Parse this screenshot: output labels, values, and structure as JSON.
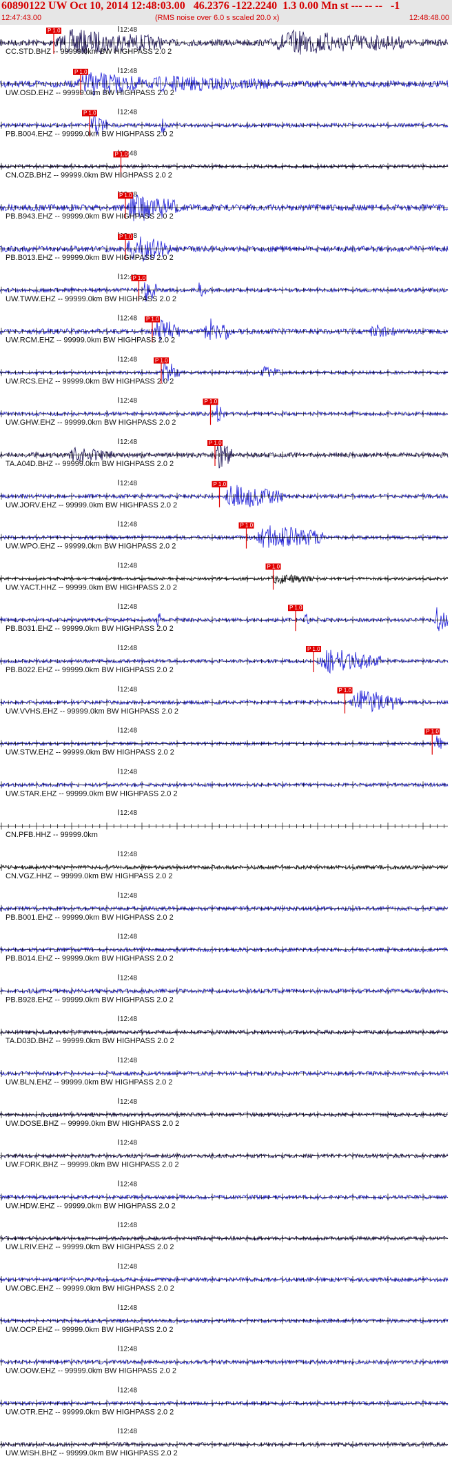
{
  "header": {
    "title": "60890122 UW Oct 10, 2014 12:48:03.00   46.2376 -122.2240  1.3 0.00 Mn st --- -- --   -1",
    "start_time": "12:47:43.00",
    "rms_note": "(RMS noise over 6.0 s scaled 20.0 x)",
    "end_time": "12:48:48.00"
  },
  "colors": {
    "title": "#d40000",
    "header_bg": "#e6e6e6",
    "pick": "#e00000",
    "trace_blue": "#1a1ad6",
    "trace_dark": "#140a50",
    "trace_black": "#000000"
  },
  "chart_data": {
    "type": "seismogram",
    "title": "60890122 UW Oct 10, 2014 12:48:03.00",
    "time_range": [
      "12:47:43.00",
      "12:48:48.00"
    ],
    "minute_label": "12:48",
    "pick_label": "P 1.0",
    "traces": [
      {
        "label": "CC.STD.BHZ -- 99999.0km BW  HIGHPASS  2.0  2",
        "pick": 0.12,
        "color": "dark",
        "amp": 1.0,
        "env": [
          [
            0.12,
            0.36,
            0.9
          ],
          [
            0.6,
            0.9,
            0.8
          ]
        ]
      },
      {
        "label": "UW.OSD.EHZ -- 99999.0km BW  HIGHPASS  2.0  2",
        "pick": 0.18,
        "color": "blue",
        "amp": 1.0,
        "env": [
          [
            0.17,
            0.32,
            0.85
          ],
          [
            0.32,
            0.6,
            0.45
          ]
        ]
      },
      {
        "label": "PB.B004.EHZ -- 99999.0km BW  HIGHPASS  2.0  2",
        "pick": 0.2,
        "color": "blue",
        "amp": 0.4,
        "env": [
          [
            0.2,
            0.24,
            1.0
          ],
          [
            0.36,
            0.37,
            0.8
          ]
        ]
      },
      {
        "label": "CN.OZB.BHZ -- 99999.0km BW  HIGHPASS  2.0  2",
        "pick": 0.27,
        "color": "dark",
        "amp": 0.35,
        "env": []
      },
      {
        "label": "PB.B943.EHZ -- 99999.0km BW  HIGHPASS  2.0  2",
        "pick": 0.28,
        "color": "blue",
        "amp": 1.0,
        "env": [
          [
            0.28,
            0.4,
            1.0
          ]
        ]
      },
      {
        "label": "PB.B013.EHZ -- 99999.0km BW  HIGHPASS  2.0  2",
        "pick": 0.28,
        "color": "blue",
        "amp": 0.8,
        "env": [
          [
            0.28,
            0.38,
            1.0
          ]
        ]
      },
      {
        "label": "UW.TWW.EHZ -- 99999.0km BW  HIGHPASS  2.0  2",
        "pick": 0.31,
        "color": "blue",
        "amp": 0.4,
        "env": [
          [
            0.32,
            0.35,
            1.0
          ],
          [
            0.44,
            0.46,
            0.6
          ]
        ]
      },
      {
        "label": "UW.RCM.EHZ -- 99999.0km BW  HIGHPASS  2.0  2",
        "pick": 0.34,
        "color": "blue",
        "amp": 0.7,
        "env": [
          [
            0.34,
            0.4,
            1.0
          ],
          [
            0.45,
            0.52,
            1.0
          ],
          [
            0.82,
            0.88,
            0.5
          ]
        ]
      },
      {
        "label": "UW.RCS.EHZ -- 99999.0km BW  HIGHPASS  2.0  2",
        "pick": 0.36,
        "color": "blue",
        "amp": 0.3,
        "env": [
          [
            0.36,
            0.4,
            1.0
          ],
          [
            0.58,
            0.63,
            0.4
          ]
        ]
      },
      {
        "label": "UW.GHW.EHZ -- 99999.0km BW  HIGHPASS  2.0  2",
        "pick": 0.47,
        "color": "blue",
        "amp": 0.35,
        "env": [
          [
            0.48,
            0.5,
            0.9
          ]
        ]
      },
      {
        "label": "TA.A04D.BHZ -- 99999.0km BW  HIGHPASS  2.0  2",
        "pick": 0.48,
        "color": "dark",
        "amp": 0.6,
        "env": [
          [
            0.48,
            0.52,
            1.0
          ],
          [
            0.15,
            0.25,
            0.5
          ]
        ]
      },
      {
        "label": "UW.JORV.EHZ -- 99999.0km BW  HIGHPASS  2.0  2",
        "pick": 0.49,
        "color": "blue",
        "amp": 0.4,
        "env": [
          [
            0.5,
            0.63,
            1.0
          ]
        ]
      },
      {
        "label": "UW.WPO.EHZ -- 99999.0km BW  HIGHPASS  2.0  2",
        "pick": 0.55,
        "color": "blue",
        "amp": 0.4,
        "env": [
          [
            0.57,
            0.72,
            1.0
          ]
        ]
      },
      {
        "label": "UW.YACT.HHZ -- 99999.0km BW  HIGHPASS  2.0  2",
        "pick": 0.61,
        "color": "black",
        "amp": 0.15,
        "env": [
          [
            0.6,
            0.7,
            0.35
          ]
        ]
      },
      {
        "label": "PB.B031.EHZ -- 99999.0km BW  HIGHPASS  2.0  2",
        "pick": 0.66,
        "color": "blue",
        "amp": 0.35,
        "env": [
          [
            0.68,
            0.69,
            0.7
          ],
          [
            0.35,
            0.36,
            0.9
          ],
          [
            0.97,
            1.0,
            1.0
          ]
        ]
      },
      {
        "label": "PB.B022.EHZ -- 99999.0km BW  HIGHPASS  2.0  2",
        "pick": 0.7,
        "color": "blue",
        "amp": 0.3,
        "env": [
          [
            0.71,
            0.85,
            1.0
          ]
        ]
      },
      {
        "label": "UW.VVHS.EHZ -- 99999.0km BW  HIGHPASS  2.0  2",
        "pick": 0.77,
        "color": "blue",
        "amp": 0.35,
        "env": [
          [
            0.78,
            0.9,
            1.0
          ]
        ]
      },
      {
        "label": "UW.STW.EHZ -- 99999.0km BW  HIGHPASS  2.0  2",
        "pick": 0.965,
        "color": "blue",
        "amp": 0.25,
        "env": [
          [
            0.97,
            0.99,
            0.6
          ]
        ]
      },
      {
        "label": "UW.STAR.EHZ -- 99999.0km BW  HIGHPASS  2.0  2",
        "pick": null,
        "color": "blue",
        "amp": 0.3,
        "env": []
      },
      {
        "label": "CN.PFB.HHZ -- 99999.0km",
        "pick": null,
        "color": "none",
        "amp": 0,
        "env": []
      },
      {
        "label": "CN.VGZ.HHZ -- 99999.0km BW  HIGHPASS  2.0  2",
        "pick": null,
        "color": "black",
        "amp": 0.35,
        "env": []
      },
      {
        "label": "PB.B001.EHZ -- 99999.0km BW  HIGHPASS  2.0  2",
        "pick": null,
        "color": "blue",
        "amp": 0.45,
        "env": []
      },
      {
        "label": "PB.B014.EHZ -- 99999.0km BW  HIGHPASS  2.0  2",
        "pick": null,
        "color": "blue",
        "amp": 0.45,
        "env": []
      },
      {
        "label": "PB.B928.EHZ -- 99999.0km BW  HIGHPASS  2.0  2",
        "pick": null,
        "color": "blue",
        "amp": 0.45,
        "env": []
      },
      {
        "label": "TA.D03D.BHZ -- 99999.0km BW  HIGHPASS  2.0  2",
        "pick": null,
        "color": "dark",
        "amp": 0.4,
        "env": []
      },
      {
        "label": "UW.BLN.EHZ -- 99999.0km BW  HIGHPASS  2.0  2",
        "pick": null,
        "color": "blue",
        "amp": 0.4,
        "env": []
      },
      {
        "label": "UW.DOSE.BHZ -- 99999.0km BW  HIGHPASS  2.0  2",
        "pick": null,
        "color": "dark",
        "amp": 0.4,
        "env": []
      },
      {
        "label": "UW.FORK.BHZ -- 99999.0km BW  HIGHPASS  2.0  2",
        "pick": null,
        "color": "dark",
        "amp": 0.4,
        "env": []
      },
      {
        "label": "UW.HDW.EHZ -- 99999.0km BW  HIGHPASS  2.0  2",
        "pick": null,
        "color": "blue",
        "amp": 0.4,
        "env": []
      },
      {
        "label": "UW.LRIV.EHZ -- 99999.0km BW  HIGHPASS  2.0  2",
        "pick": null,
        "color": "dark",
        "amp": 0.4,
        "env": []
      },
      {
        "label": "UW.OBC.EHZ -- 99999.0km BW  HIGHPASS  2.0  2",
        "pick": null,
        "color": "blue",
        "amp": 0.4,
        "env": []
      },
      {
        "label": "UW.OCP.EHZ -- 99999.0km BW  HIGHPASS  2.0  2",
        "pick": null,
        "color": "blue",
        "amp": 0.4,
        "env": []
      },
      {
        "label": "UW.OOW.EHZ -- 99999.0km BW  HIGHPASS  2.0  2",
        "pick": null,
        "color": "blue",
        "amp": 0.4,
        "env": []
      },
      {
        "label": "UW.OTR.EHZ -- 99999.0km BW  HIGHPASS  2.0  2",
        "pick": null,
        "color": "blue",
        "amp": 0.4,
        "env": []
      },
      {
        "label": "UW.WISH.BHZ -- 99999.0km BW  HIGHPASS  2.0  2",
        "pick": null,
        "color": "dark",
        "amp": 0.4,
        "env": []
      }
    ]
  }
}
